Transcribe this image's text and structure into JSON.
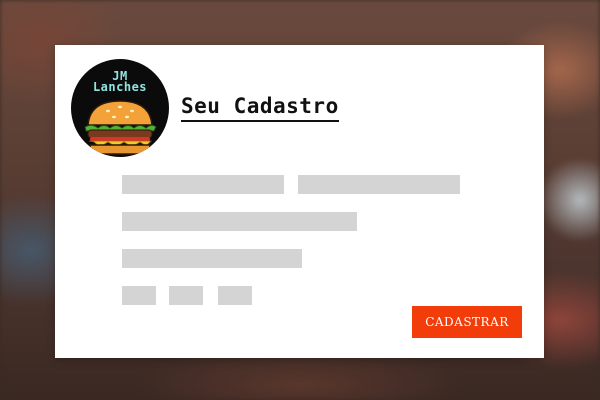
{
  "logo": {
    "line1": "JM",
    "line2": "Lanches",
    "icon": "burger-icon"
  },
  "form": {
    "title": "Seu Cadastro",
    "submit_label": "CADASTRAR"
  },
  "colors": {
    "accent": "#f23d0b",
    "placeholder": "#d4d4d4",
    "logo_bg": "#0b0b0b",
    "logo_text": "#8fe3e0"
  }
}
